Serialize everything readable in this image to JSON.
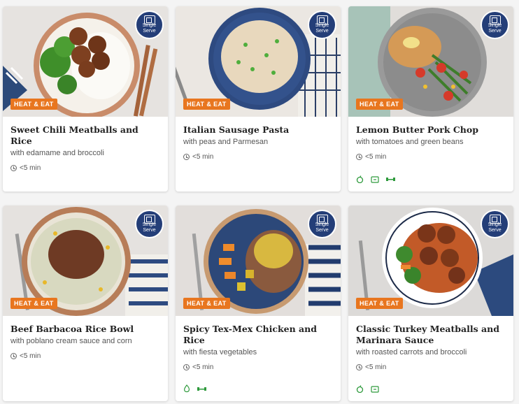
{
  "cards": [
    {
      "title": "Sweet Chili Meatballs and Rice",
      "subtitle": "with edamame and broccoli",
      "time": "<5 min",
      "tag": "HEAT & EAT",
      "badge": {
        "line1": "Single",
        "line2": "Serve"
      },
      "icons": []
    },
    {
      "title": "Italian Sausage Pasta",
      "subtitle": "with peas and Parmesan",
      "time": "<5 min",
      "tag": "HEAT & EAT",
      "badge": {
        "line1": "Single",
        "line2": "Serve"
      },
      "icons": []
    },
    {
      "title": "Lemon Butter Pork Chop",
      "subtitle": "with tomatoes and green beans",
      "time": "<5 min",
      "tag": "HEAT & EAT",
      "badge": {
        "line1": "Single",
        "line2": "Serve"
      },
      "icons": [
        "apple-icon",
        "carb-smart-icon",
        "protein-dumbbell-icon"
      ]
    },
    {
      "title": "Beef Barbacoa Rice Bowl",
      "subtitle": "with poblano cream sauce and corn",
      "time": "<5 min",
      "tag": "HEAT & EAT",
      "badge": {
        "line1": "Single",
        "line2": "Serve"
      },
      "icons": []
    },
    {
      "title": "Spicy Tex-Mex Chicken and Rice",
      "subtitle": "with fiesta vegetables",
      "time": "<5 min",
      "tag": "HEAT & EAT",
      "badge": {
        "line1": "Single",
        "line2": "Serve"
      },
      "icons": [
        "calorie-smart-icon",
        "protein-dumbbell-icon"
      ]
    },
    {
      "title": "Classic Turkey Meatballs and Marinara Sauce",
      "subtitle": "with roasted carrots and broccoli",
      "time": "<5 min",
      "tag": "HEAT & EAT",
      "badge": {
        "line1": "Single",
        "line2": "Serve"
      },
      "icons": [
        "apple-icon",
        "carb-smart-icon"
      ]
    }
  ],
  "colors": {
    "tag": "#e8761f",
    "badge": "#243e78",
    "icon_green": "#2e9a3c"
  }
}
